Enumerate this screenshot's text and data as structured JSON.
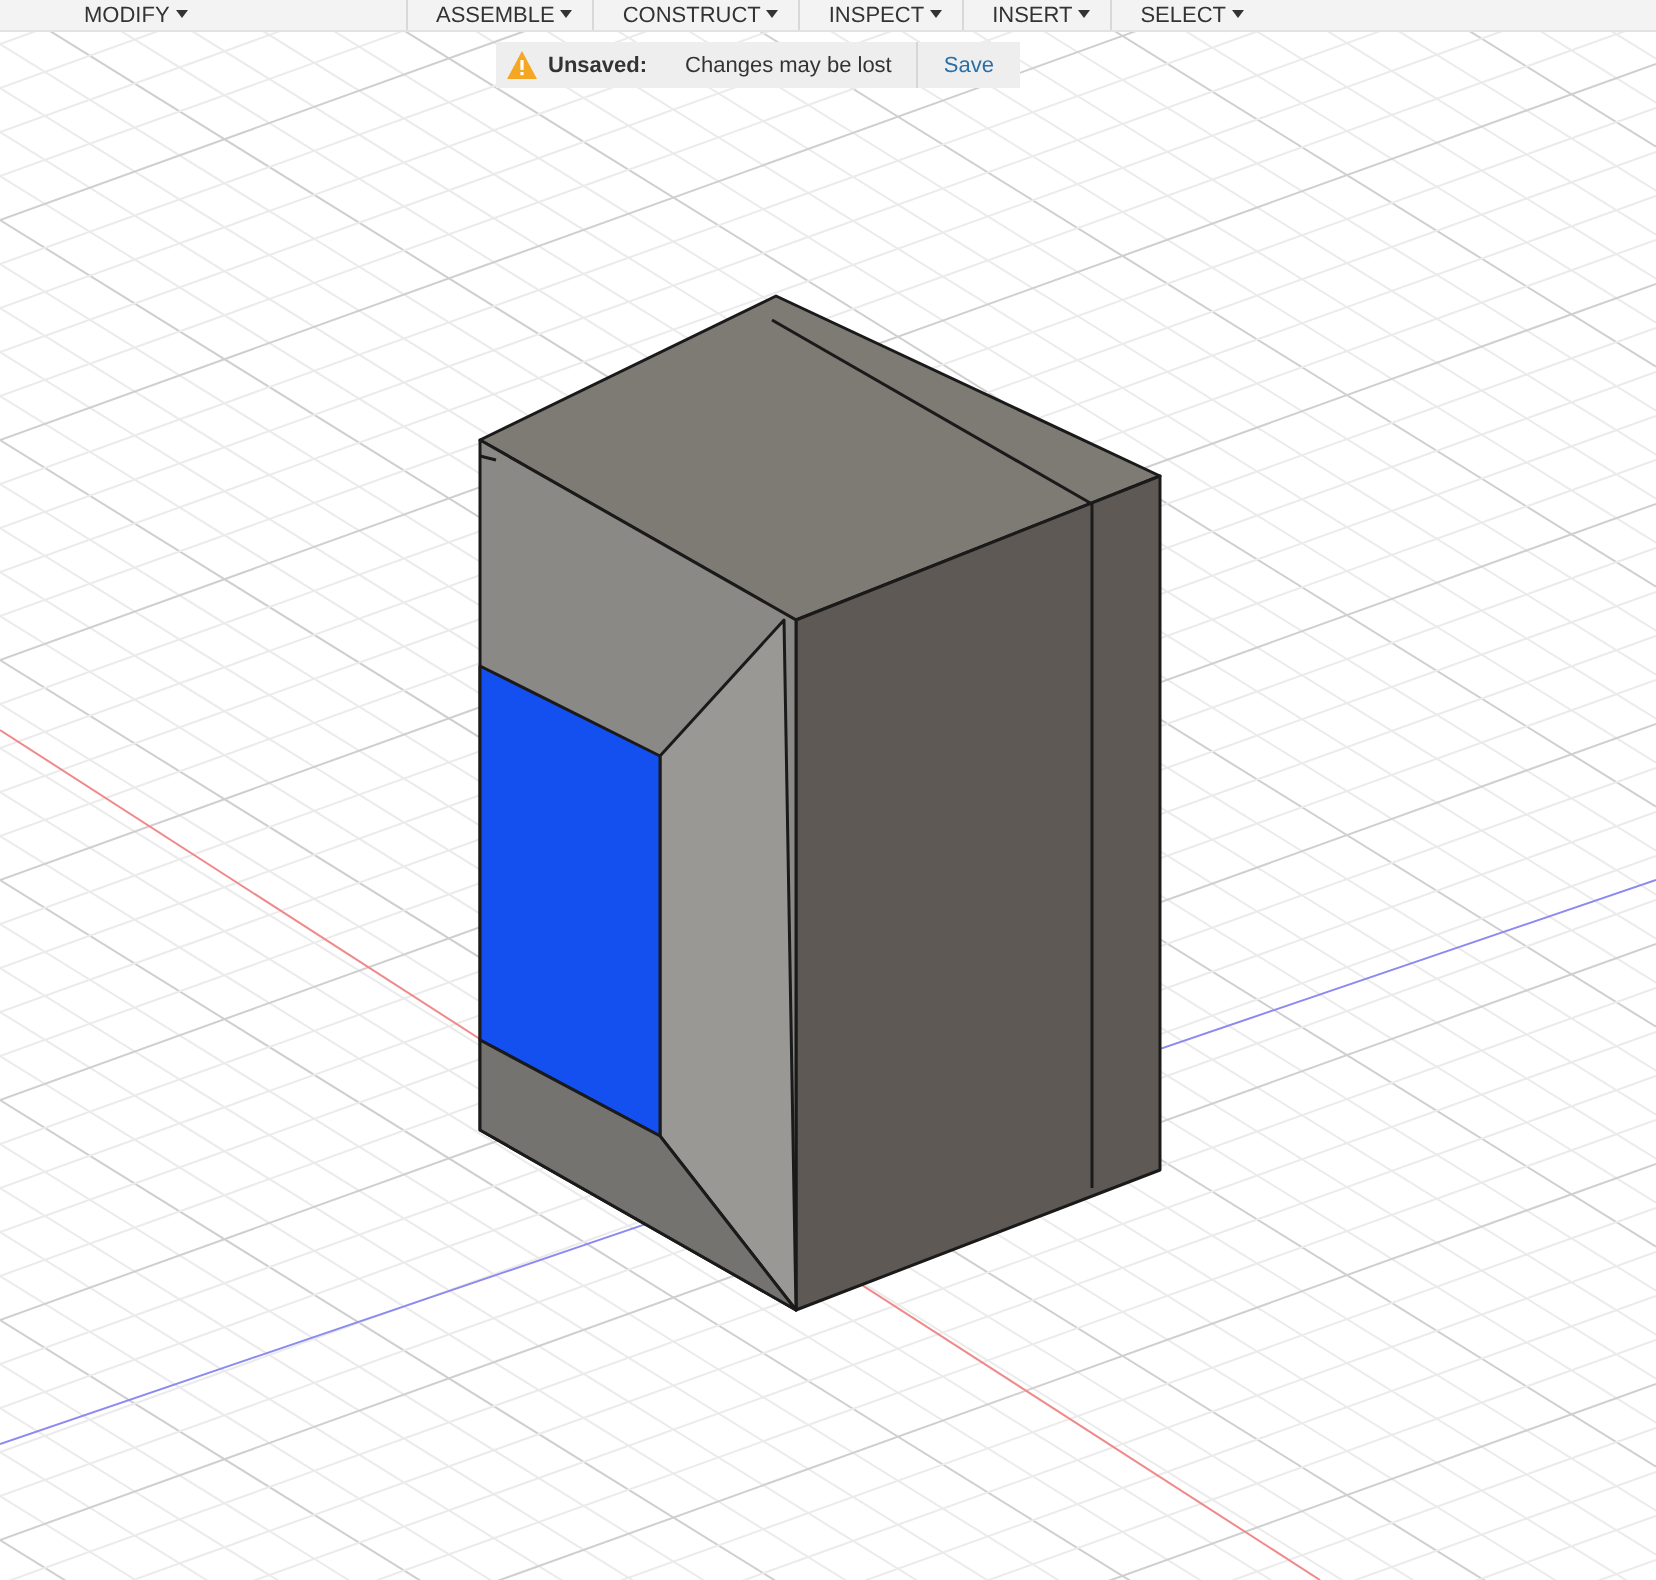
{
  "toolbar": {
    "menus": [
      {
        "label": "MODIFY"
      },
      {
        "label": "ASSEMBLE"
      },
      {
        "label": "CONSTRUCT"
      },
      {
        "label": "INSPECT"
      },
      {
        "label": "INSERT"
      },
      {
        "label": "SELECT"
      }
    ]
  },
  "notification": {
    "label": "Unsaved:",
    "message": "Changes may be lost",
    "action": "Save"
  }
}
